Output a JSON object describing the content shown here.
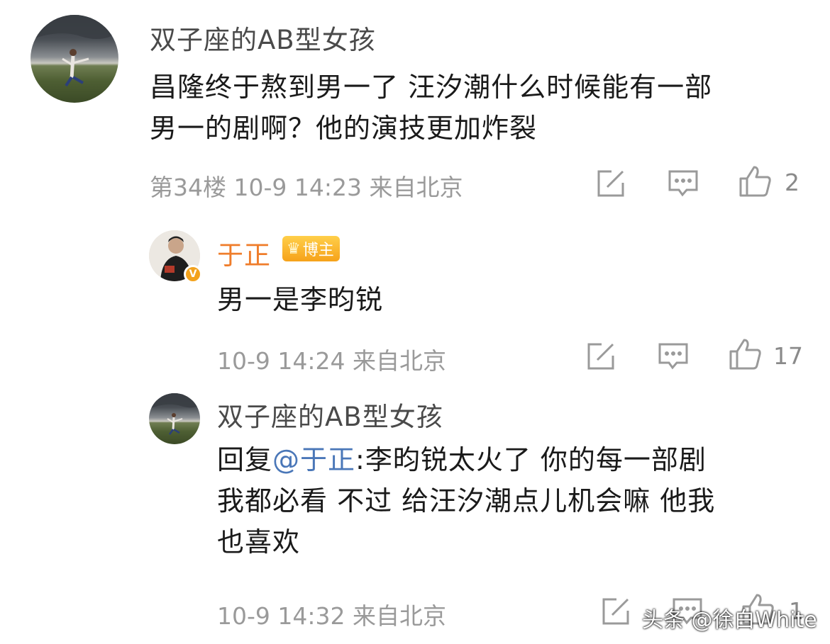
{
  "comments": [
    {
      "username": "双子座的AB型女孩",
      "text_lines": [
        "昌隆终于熬到男一了  汪汐潮什么时候能有一部",
        "男一的剧啊？他的演技更加炸裂"
      ],
      "floor": "第34楼",
      "time": "10-9 14:23",
      "location": "来自北京",
      "likes": "2"
    },
    {
      "username": "于正",
      "badge": "博主",
      "text_lines": [
        "男一是李昀锐"
      ],
      "time": "10-9 14:24",
      "location": "来自北京",
      "likes": "17"
    },
    {
      "username": "双子座的AB型女孩",
      "reply_prefix": "回复",
      "mention": "@于正",
      "first_line_rest": ":李昀锐太火了 你的每一部剧",
      "text_lines": [
        "我都必看 不过 给汪汐潮点儿机会嘛 他我",
        "也喜欢"
      ],
      "time": "10-9 14:32",
      "location": "来自北京",
      "likes": "1"
    }
  ],
  "watermark": "头条 @徐白White",
  "icons": [
    "edit-icon",
    "comment-icon",
    "like-icon",
    "verified-icon",
    "crown-icon"
  ],
  "colors": {
    "blogger_name": "#ef7d2b",
    "mention": "#4a77b8",
    "meta": "#9a9a9a"
  }
}
